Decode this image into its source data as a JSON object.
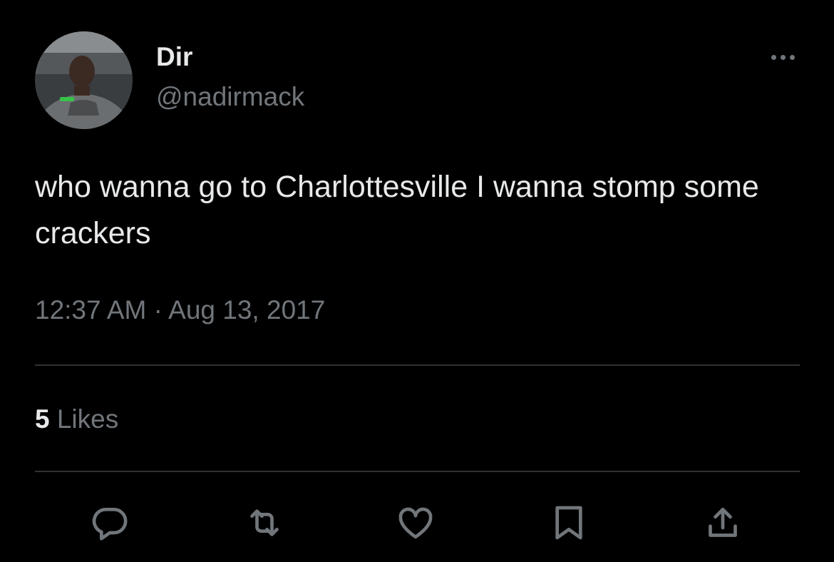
{
  "author": {
    "display_name": "Dir",
    "handle": "@nadirmack",
    "avatar_icon": "profile-photo"
  },
  "tweet": {
    "text": "who wanna go to Charlottesville I wanna stomp some crackers",
    "timestamp": "12:37 AM · Aug 13, 2017"
  },
  "stats": {
    "likes_count": "5",
    "likes_label": "Likes"
  },
  "actions": [
    {
      "name": "reply",
      "icon": "reply-icon"
    },
    {
      "name": "retweet",
      "icon": "retweet-icon"
    },
    {
      "name": "like",
      "icon": "heart-icon"
    },
    {
      "name": "bookmark",
      "icon": "bookmark-icon"
    },
    {
      "name": "share",
      "icon": "share-icon"
    }
  ],
  "colors": {
    "background": "#000000",
    "primary_text": "#e7e9ea",
    "secondary_text": "#71767b",
    "divider": "#2f3336"
  }
}
